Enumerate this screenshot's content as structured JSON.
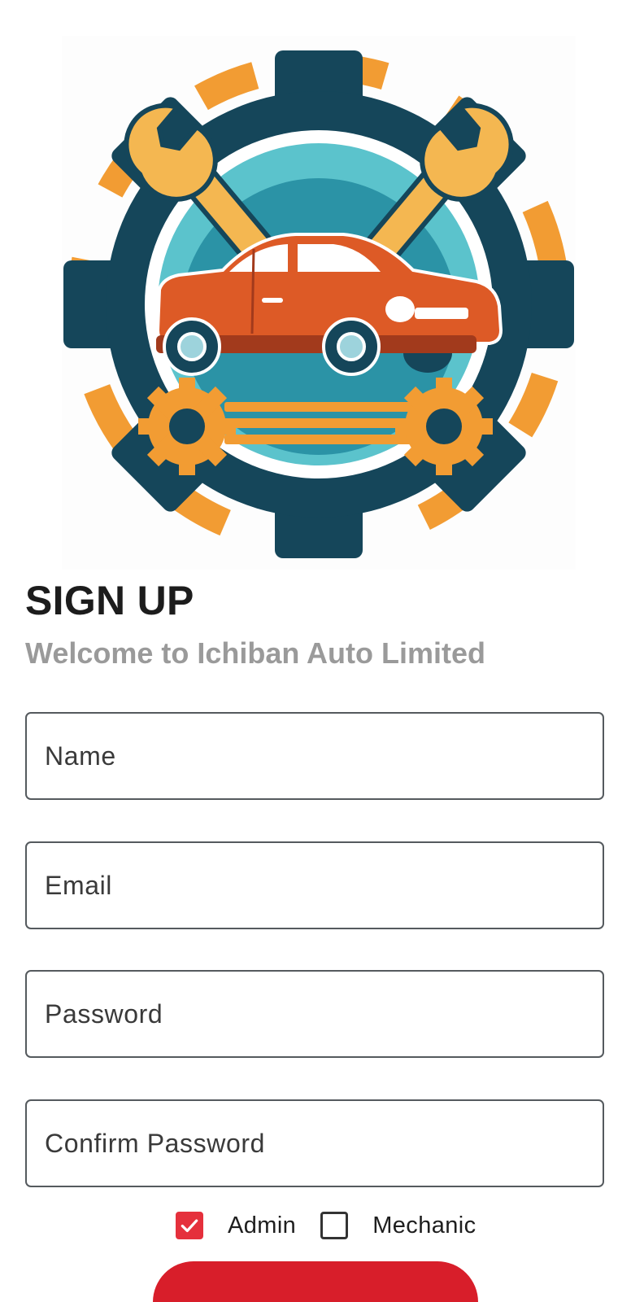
{
  "header": {
    "title": "SIGN UP",
    "subtitle": "Welcome to Ichiban Auto Limited"
  },
  "logo": {
    "icon": "auto-repair-gear-car-logo",
    "colors": {
      "navy": "#15465a",
      "teal": "#2b93a6",
      "teal_light": "#5bc3cc",
      "orange": "#f29c33",
      "wrench": "#f4b751",
      "car_body": "#dd5a26",
      "car_dark": "#a23a1c"
    }
  },
  "form": {
    "name": {
      "placeholder": "Name",
      "value": ""
    },
    "email": {
      "placeholder": "Email",
      "value": ""
    },
    "password": {
      "placeholder": "Password",
      "value": ""
    },
    "confirm_password": {
      "placeholder": "Confirm Password",
      "value": ""
    }
  },
  "roles": [
    {
      "label": "Admin",
      "checked": true
    },
    {
      "label": "Mechanic",
      "checked": false
    }
  ],
  "colors": {
    "accent": "#e5303c",
    "button": "#d81e2a",
    "subtitle": "#9a9a9a",
    "field_border": "#555a5e"
  }
}
